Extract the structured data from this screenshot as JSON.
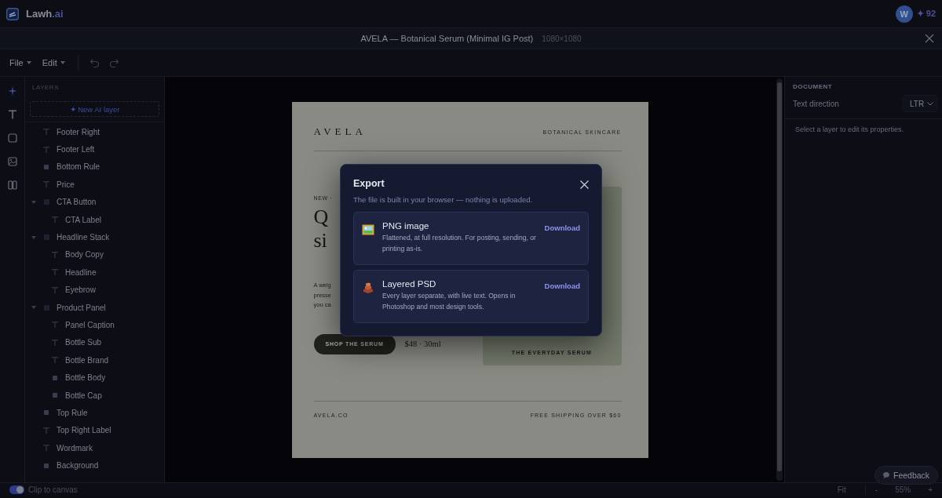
{
  "app": {
    "brand": "Lawh",
    "brand_suffix": ".ai",
    "avatar": "W",
    "credits": "✦ 92"
  },
  "document": {
    "title": "AVELA — Botanical Serum (Minimal IG Post)",
    "size": "1080×1080"
  },
  "menu": [
    "File",
    "Edit"
  ],
  "layers_panel": {
    "heading": "LAYERS",
    "new_button": "✦ New AI layer",
    "layers": [
      {
        "kind": "text",
        "name": "Footer Right"
      },
      {
        "kind": "text",
        "name": "Footer Left"
      },
      {
        "kind": "shape",
        "name": "Bottom Rule"
      },
      {
        "kind": "text",
        "name": "Price"
      },
      {
        "kind": "group",
        "name": "CTA Button",
        "expanded": true,
        "children": [
          {
            "kind": "text",
            "name": "CTA Label"
          }
        ]
      },
      {
        "kind": "group",
        "name": "Headline Stack",
        "expanded": true,
        "children": [
          {
            "kind": "text",
            "name": "Body Copy"
          },
          {
            "kind": "text",
            "name": "Headline"
          },
          {
            "kind": "text",
            "name": "Eyebrow"
          }
        ]
      },
      {
        "kind": "group",
        "name": "Product Panel",
        "expanded": true,
        "children": [
          {
            "kind": "text",
            "name": "Panel Caption"
          },
          {
            "kind": "text",
            "name": "Bottle Sub"
          },
          {
            "kind": "text",
            "name": "Bottle Brand"
          },
          {
            "kind": "shape",
            "name": "Bottle Body"
          },
          {
            "kind": "shape",
            "name": "Bottle Cap"
          }
        ]
      },
      {
        "kind": "shape",
        "name": "Top Rule"
      },
      {
        "kind": "text",
        "name": "Top Right Label"
      },
      {
        "kind": "text",
        "name": "Wordmark"
      },
      {
        "kind": "shape",
        "name": "Background"
      }
    ]
  },
  "poster": {
    "wordmark": "AVELA",
    "top_right_label": "BOTANICAL SKINCARE",
    "eyebrow": "NEW ·",
    "headline_lines": [
      "Q",
      "si"
    ],
    "body_lines": [
      "A weig",
      "presse",
      "you ca"
    ],
    "cta": "SHOP THE SERUM",
    "price": "$48 · 30ml",
    "panel_caption": "THE EVERYDAY SERUM",
    "footer_left": "AVELA.CO",
    "footer_right": "FREE SHIPPING OVER $60"
  },
  "properties": {
    "heading": "DOCUMENT",
    "label": "Text direction",
    "value": "LTR",
    "hint": "Select a layer to edit its properties."
  },
  "status": {
    "clip_label": "Clip to canvas",
    "clip_on": true,
    "fit": "Fit",
    "zoom_out": "-",
    "zoom": "55%",
    "zoom_in": "+"
  },
  "feedback": "Feedback",
  "dialog": {
    "title": "Export",
    "subtitle": "The file is built in your browser — nothing is uploaded.",
    "options": [
      {
        "kind": "png",
        "title": "PNG image",
        "description": "Flattened, at full resolution. For posting, sending, or printing as-is.",
        "action": "Download"
      },
      {
        "kind": "psd",
        "title": "Layered PSD",
        "description": "Every layer separate, with live text. Opens in Photoshop and most design tools.",
        "action": "Download"
      }
    ]
  }
}
